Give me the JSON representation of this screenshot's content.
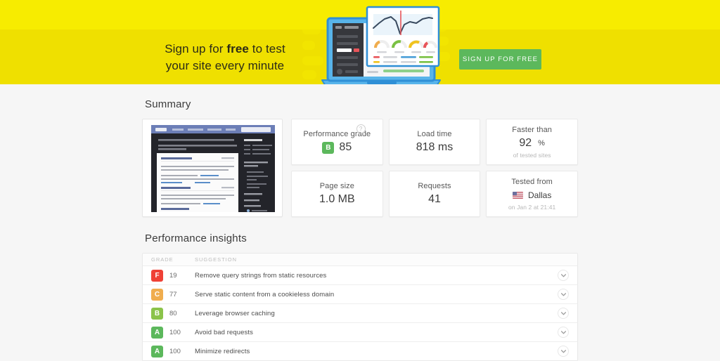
{
  "promo": {
    "line1_prefix": "Sign up for ",
    "line1_strong": "free",
    "line1_suffix": " to test",
    "line2": "your site every minute",
    "cta_label": "SIGN UP FOR FREE",
    "cta_color": "#5cb85c",
    "banner_color": "#efe000",
    "banner_color_top": "#f7ec00"
  },
  "summary": {
    "title": "Summary",
    "screenshot_alt": "php.net site screenshot thumbnail",
    "cards": [
      {
        "label": "Performance grade",
        "grade": "B",
        "grade_color": "#5cb85c",
        "value": "85",
        "sub": "",
        "has_info_icon": true,
        "info_icon": "question-mark-circle"
      },
      {
        "label": "Load time",
        "value": "818 ms",
        "sub": "",
        "has_info_icon": false
      },
      {
        "label": "Faster than",
        "value": "92",
        "unit": "%",
        "sub": "of tested sites",
        "has_info_icon": false
      },
      {
        "label": "Page size",
        "value": "1.0 MB",
        "sub": "",
        "has_info_icon": false
      },
      {
        "label": "Requests",
        "value": "41",
        "sub": "",
        "has_info_icon": false
      },
      {
        "label": "Tested from",
        "value": "Dallas",
        "flag": "us-flag",
        "sub": "on Jan 2 at 21:41",
        "has_info_icon": false
      }
    ]
  },
  "insights": {
    "title": "Performance insights",
    "columns": {
      "grade": "GRADE",
      "suggestion": "SUGGESTION"
    },
    "rows": [
      {
        "grade": "F",
        "grade_color": "#ef4136",
        "score": "19",
        "suggestion": "Remove query strings from static resources"
      },
      {
        "grade": "C",
        "grade_color": "#f0ad4e",
        "score": "77",
        "suggestion": "Serve static content from a cookieless domain"
      },
      {
        "grade": "B",
        "grade_color": "#8bc34a",
        "score": "80",
        "suggestion": "Leverage browser caching"
      },
      {
        "grade": "A",
        "grade_color": "#5cb85c",
        "score": "100",
        "suggestion": "Avoid bad requests"
      },
      {
        "grade": "A",
        "grade_color": "#5cb85c",
        "score": "100",
        "suggestion": "Minimize redirects"
      }
    ]
  }
}
